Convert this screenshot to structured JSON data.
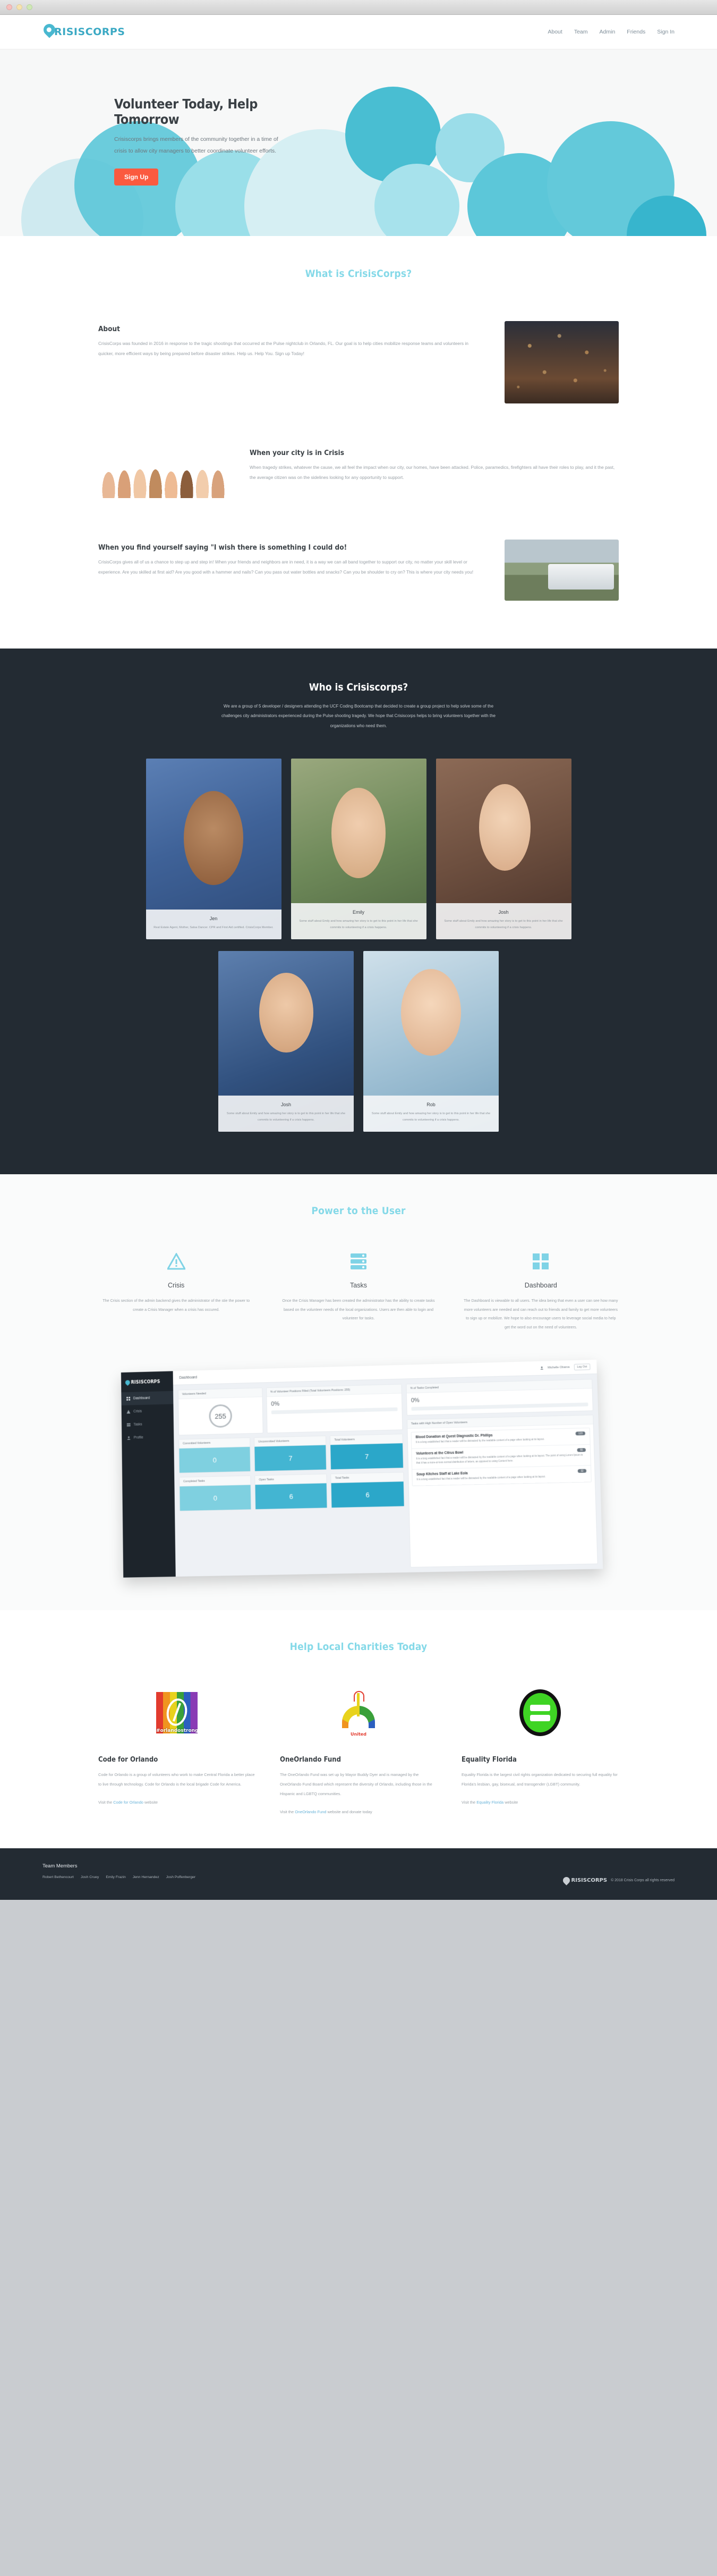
{
  "window": {
    "dots": [
      "close",
      "minimize",
      "zoom"
    ]
  },
  "nav": {
    "brand_initial": "C",
    "brand": "RISISCORPS",
    "links": [
      {
        "label": "About"
      },
      {
        "label": "Team"
      },
      {
        "label": "Admin"
      },
      {
        "label": "Friends"
      },
      {
        "label": "Sign In"
      }
    ]
  },
  "hero": {
    "title": "Volunteer Today, Help Tomorrow",
    "subtitle": "Crisiscorps brings members of the community together in a time of crisis to allow city managers to better coordinate volunteer efforts.",
    "cta": "Sign Up"
  },
  "what": {
    "title": "What is CrisisCorps?",
    "blocks": [
      {
        "heading": "About",
        "body": "CrisisCorps was founded in 2016 in response to the tragic shootings that occurred at the Pulse nightclub in Orlando, FL. Our goal is to help cities mobilize response teams and volunteers in quicker, more efficient ways by being prepared before disaster strikes. Help us. Help You. Sign up Today!",
        "image": "crowd-vigil-photo"
      },
      {
        "heading": "When your city is in Crisis",
        "body": "When tragedy strikes, whatever the cause, we all feel the impact when our city, our homes, have been attacked. Police, paramedics, firefighters all have their roles to play, and it the past, the average citizen was on the sidelines looking for any opportunity to support.",
        "image": "raised-hands-photo"
      },
      {
        "heading": "When you find yourself saying \"I wish there is something I could do!",
        "body": "CrisisCorps gives all of us a chance to step up and step in! When your friends and neighbors are in need, it is a way we can all band together to support our city, no matter your skill level or experience. Are you skilled at first aid? Are you good with a hammer and nails? Can you pass out water bottles and snacks? Can you be shoulder to cry on? This is where your city needs you!",
        "image": "rescue-truck-photo"
      }
    ]
  },
  "who": {
    "title": "Who is Crisiscorps?",
    "intro": "We are a group of 5 developer / designers attending the UCF Coding Bootcamp that decided to create a group project to help solve some of the challenges city administrators experienced during the Pulse shooting tragedy. We hope that Crisiscorps helps to bring volunteers together with the organizations who need them.",
    "members_row1": [
      {
        "name": "Jen",
        "bio": "Real Estate Agent, Mother, Salsa Dancer. CPR and First Aid certified. CrisisCorps Member."
      },
      {
        "name": "Emily",
        "bio": "Some stuff about Emily and how amazing her story is to get to this point in her life that she commits to volunteering if a crisis happens."
      },
      {
        "name": "Josh",
        "bio": "Some stuff about Emily and how amazing her story is to get to this point in her life that she commits to volunteering if a crisis happens."
      }
    ],
    "members_row2": [
      {
        "name": "Josh",
        "bio": "Some stuff about Emily and how amazing her story is to get to this point in her life that she commits to volunteering if a crisis happens."
      },
      {
        "name": "Rob",
        "bio": "Some stuff about Emily and how amazing her story is to get to this point in her life that she commits to volunteering if a crisis happens."
      }
    ]
  },
  "power": {
    "title": "Power to the User",
    "columns": [
      {
        "icon": "warning-triangle-icon",
        "heading": "Crisis",
        "body": "The Crisis section of the admin backend gives the administrator of the stie the power to create a Crisis Manager when a crisis has occured."
      },
      {
        "icon": "server-stack-icon",
        "heading": "Tasks",
        "body": "Once the Crisis Manager has been created the administrator has the ability to create tasks based on the volunteer needs of the local organizations. Users are then able to login and volunteer for tasks."
      },
      {
        "icon": "dashboard-grid-icon",
        "heading": "Dashboard",
        "body": "The Dashboard is viewable to all users. The idea being that even a user can see how many more volunteers are needed and can reach out to friends and family to get more volunteers to sign up or mobilize. We hope to also encourage users to leverage social media to help get the word out on the need of volunteers."
      }
    ]
  },
  "dashboard": {
    "brand_initial": "C",
    "brand": "RISISCORPS",
    "sidebar": [
      {
        "label": "Dashboard",
        "icon": "grid-icon",
        "active": true
      },
      {
        "label": "Crisis",
        "icon": "warning-icon",
        "active": false
      },
      {
        "label": "Tasks",
        "icon": "list-icon",
        "active": false
      },
      {
        "label": "Profile",
        "icon": "person-icon",
        "active": false
      }
    ],
    "page_title": "Dashboard",
    "user": "Michelle Obama",
    "logout": "Log Out",
    "volunteers_needed_label": "Volunteers Needed",
    "volunteers_needed_value": "255",
    "positions_filled_label": "% of Volunteer Positions Filled (Total Volunteers Positions: 255)",
    "positions_filled_value": "0%",
    "tasks_completed_label": "% of Tasks Completed",
    "tasks_completed_value": "0%",
    "tiles": [
      {
        "label": "Committed Volunteers",
        "value": "0",
        "tone": "t1"
      },
      {
        "label": "Uncommitted Volunteers",
        "value": "7",
        "tone": "t2"
      },
      {
        "label": "Total Volunteers",
        "value": "7",
        "tone": "t3"
      },
      {
        "label": "Completed Tasks",
        "value": "0",
        "tone": "t1"
      },
      {
        "label": "Open Tasks",
        "value": "6",
        "tone": "t2"
      },
      {
        "label": "Total Tasks",
        "value": "6",
        "tone": "t3"
      }
    ],
    "tasks_panel_label": "Tasks with High Number of Open Volunteers",
    "tasks": [
      {
        "title": "Blood Donation at Quest Diagnostic Dr. Phillips",
        "badge": "123",
        "desc": "It is a long established fact that a reader will be distracted by the readable content of a page when looking at its layout."
      },
      {
        "title": "Volunteers at the Citrus Bowl",
        "badge": "55",
        "desc": "It is a long established fact that a reader will be distracted by the readable content of a page when looking at its layout. The point of using Lorem Ipsum is that it has a more-or-less normal distribution of letters, as opposed to using Content here."
      },
      {
        "title": "Soup Kitches Staff at Lake Eola",
        "badge": "32",
        "desc": "It is a long established fact that a reader will be distracted by the readable content of a page when looking at its layout."
      }
    ]
  },
  "charities": {
    "title": "Help Local Charities Today",
    "items": [
      {
        "logo": "code-for-orlando-logo",
        "logo_tag": "#orlandostrong",
        "heading": "Code for Orlando",
        "body": "Code for Orlando is a group of volunteers who work to make Central Florida a better place to live through technology. Code for Orlando is the local brigade Code for America.",
        "link_prefix": "Visit the ",
        "link_text": "Code for Orlando",
        "link_suffix": " website"
      },
      {
        "logo": "oneorlando-fund-logo",
        "logo_tag": "United",
        "heading": "OneOrlando Fund",
        "body": "The OneOrlando Fund was set up by Mayor Buddy Dyer and is managed by the OneOrlando Fund Board which represent the diversity of Orlando, including those in the Hispanic and LGBTQ communities.",
        "link_prefix": "Visit the ",
        "link_text": "OneOrlando Fund",
        "link_suffix": " website and donate today"
      },
      {
        "logo": "equality-florida-logo",
        "logo_tag": "",
        "heading": "Equality Florida",
        "body": "Equality Florida is the largest civil rights organization dedicated to securing full equality for Florida's lesbian, gay, bisexual, and transgender (LGBT) community.",
        "link_prefix": "Visit the ",
        "link_text": "Equality Florida",
        "link_suffix": " website"
      }
    ]
  },
  "footer": {
    "heading": "Team Members",
    "names": [
      "Robert Bethencourt",
      "Josh Cruey",
      "Emily Frazin",
      "Jenn Hernandez",
      "Josh Poffenberger"
    ],
    "brand_initial": "C",
    "brand": "RISISCORPS",
    "copyright": "© 2018 Crisis Corps all rights reserved"
  }
}
